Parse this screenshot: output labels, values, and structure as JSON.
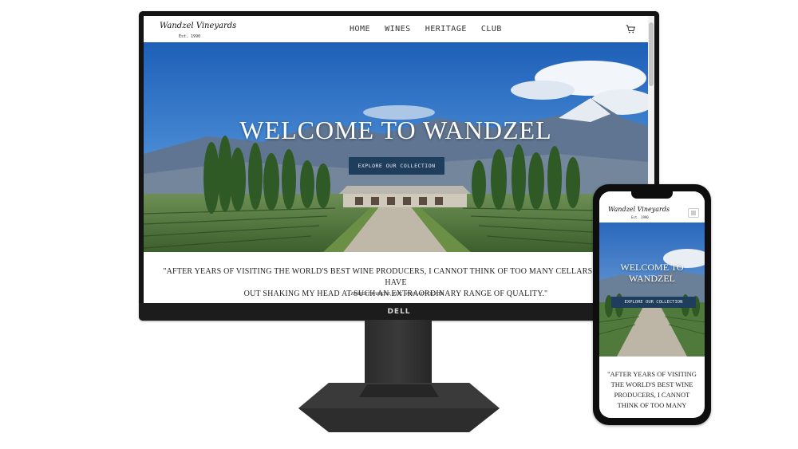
{
  "site": {
    "logo": "Wandzel Vineyards",
    "logo_sub": "Est. 1990",
    "nav": [
      "HOME",
      "WINES",
      "HERITAGE",
      "CLUB"
    ],
    "hero_title": "WELCOME TO WANDZEL",
    "mobile_hero_title": [
      "WELCOME TO",
      "WANDZEL"
    ],
    "cta": "EXPLORE OUR COLLECTION",
    "quote": "\"AFTER YEARS OF VISITING THE WORLD'S BEST WINE PRODUCERS, I CANNOT THINK OF TOO MANY CELLARS WHERE I HAVE",
    "quote_line2": "OUT SHAKING MY HEAD AT SUCH AN EXTRAORDINARY RANGE OF QUALITY.\"",
    "quote_author": "- ROBERT PARKER, THE WINE ADVOCATE",
    "mobile_quote": "\"AFTER YEARS OF VISITING THE WORLD'S BEST WINE PRODUCERS, I CANNOT THINK OF TOO MANY"
  },
  "device": {
    "monitor_brand": "DELL"
  },
  "icons": [
    "cart-icon",
    "hamburger-menu-icon"
  ],
  "colors": {
    "cta_background": "#1f3d5c",
    "sky": "#2f6fc4",
    "mountains": "#5a7089",
    "vines": "#4d7a3a"
  }
}
